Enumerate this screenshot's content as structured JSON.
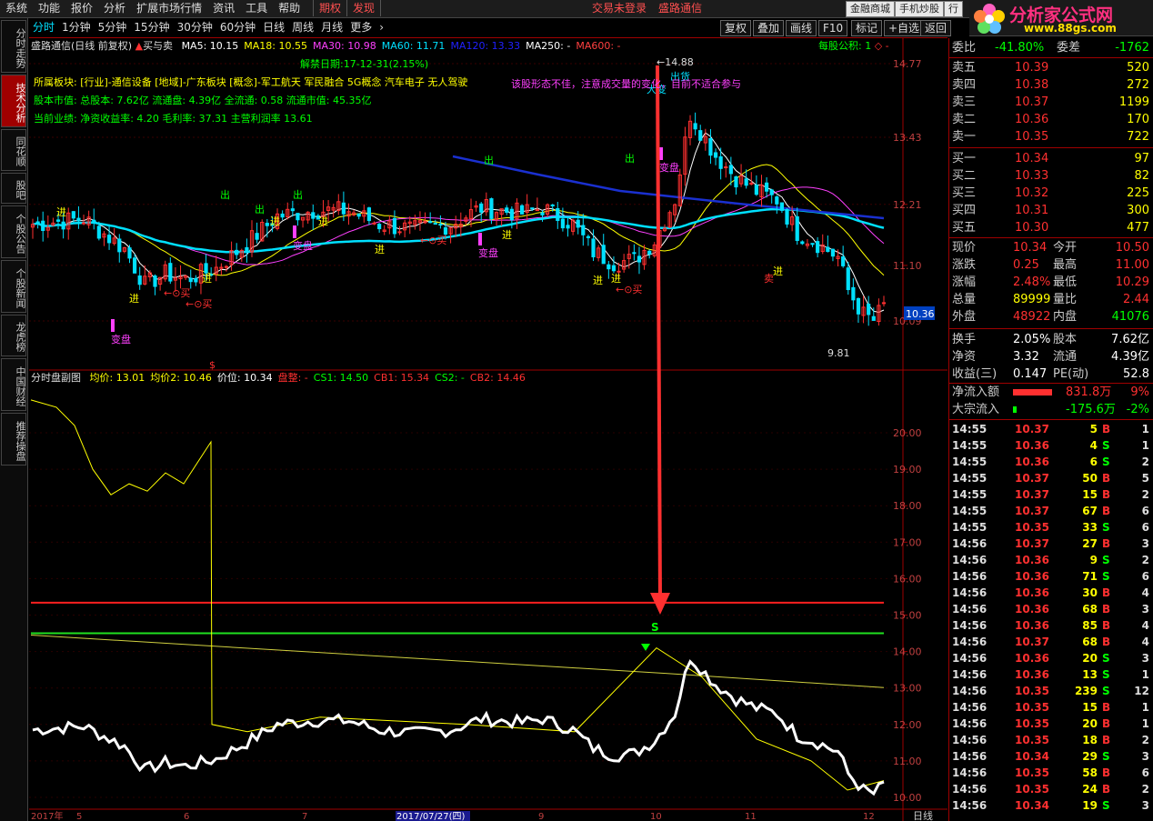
{
  "menu": {
    "items": [
      "系统",
      "功能",
      "报价",
      "分析",
      "扩展市场行情",
      "资讯",
      "工具",
      "帮助"
    ],
    "center_items": [
      "期权",
      "发现"
    ],
    "status": "交易未登录",
    "stock_name_title": "盛路通信",
    "right_buttons": [
      "金融商城",
      "手机炒股",
      "行"
    ]
  },
  "logo": {
    "title": "分析家公式网",
    "url": "www.88gs.com"
  },
  "left_tabs": [
    "分时走势",
    "技术分析",
    "同花顺",
    "股吧",
    "个股公告",
    "个股新闻",
    "龙虎榜",
    "中国财经",
    "推荐操盘"
  ],
  "period_bar": {
    "items": [
      "分时",
      "1分钟",
      "5分钟",
      "15分钟",
      "30分钟",
      "60分钟",
      "日线",
      "周线",
      "月线",
      "更多",
      "›"
    ],
    "active": "分时",
    "right_buttons": [
      "复权",
      "叠加",
      "画线",
      "F10",
      "标记",
      "+自选",
      "返回"
    ]
  },
  "main_chart": {
    "title": "盛路通信(日线 前复权)",
    "indicator_name": "买与卖",
    "ma": [
      {
        "label": "MA5: 10.15",
        "color": "#ffffff"
      },
      {
        "label": "MA18: 10.55",
        "color": "#ffff00"
      },
      {
        "label": "MA30: 10.98",
        "color": "#ff40ff"
      },
      {
        "label": "MA60: 11.71",
        "color": "#00e0ff"
      },
      {
        "label": "MA120: 13.33",
        "color": "#2020ff"
      },
      {
        "label": "MA250: -",
        "color": "#ffffff"
      },
      {
        "label": "MA600: -",
        "color": "#ff4040"
      }
    ],
    "right_info": "每股公积: 1",
    "unlock": "解禁日期:17-12-31(2.15%)",
    "info_lines": [
      "所属板块: [行业]-通信设备 [地域]-广东板块 [概念]-军工航天 军民融合 5G概念 汽车电子 无人驾驶",
      "股本市值: 总股本: 7.62亿 流通盘: 4.39亿 全流通: 0.58 流通市值: 45.35亿",
      "当前业绩: 净资收益率: 4.20 毛利率: 37.31 主营利润率 13.61"
    ],
    "warning": "该股形态不佳，注意成交量的变化，目前不适合参与",
    "y_ticks": [
      "14.77",
      "13.43",
      "12.21",
      "11.10",
      "10.09"
    ],
    "price_tag": "10.36",
    "high_label": "14.88",
    "low_label": "9.81",
    "signal_labels": {
      "jin": "进",
      "chu": "出",
      "buy": "买",
      "sell": "卖",
      "bianpan": "变盘",
      "chuhuo": "出货",
      "dabian": "大变"
    },
    "colors": {
      "up": "#ff3030",
      "down": "#00e0ff"
    }
  },
  "sub_chart": {
    "title": "分时盘副图",
    "items": [
      {
        "label": "均价: 13.01",
        "color": "#ffff00"
      },
      {
        "label": "均价2: 10.46",
        "color": "#ffff00"
      },
      {
        "label": "价位: 10.34",
        "color": "#ffffff"
      },
      {
        "label": "盘整: -",
        "color": "#ff3030"
      },
      {
        "label": "CS1: 14.50",
        "color": "#00ff00"
      },
      {
        "label": "CB1: 15.34",
        "color": "#ff3030"
      },
      {
        "label": "CS2: -",
        "color": "#00ff00"
      },
      {
        "label": "CB2: 14.46",
        "color": "#ff3030"
      }
    ],
    "y_ticks": [
      "20.00",
      "19.00",
      "18.00",
      "17.00",
      "16.00",
      "15.00",
      "14.00",
      "13.00",
      "12.00",
      "11.00",
      "10.00"
    ],
    "s_marker": "S",
    "dollar": "$"
  },
  "x_axis": {
    "labels": [
      "2017年",
      "5",
      "6",
      "7",
      "2017/07/27(四)",
      "9",
      "10",
      "11",
      "12"
    ],
    "right": "日线"
  },
  "quote": {
    "header_l": "委比",
    "header_lv": "-41.80%",
    "header_r": "委差",
    "header_rv": "-1762",
    "sell": [
      {
        "label": "卖五",
        "price": "10.39",
        "vol": "520"
      },
      {
        "label": "卖四",
        "price": "10.38",
        "vol": "272"
      },
      {
        "label": "卖三",
        "price": "10.37",
        "vol": "1199"
      },
      {
        "label": "卖二",
        "price": "10.36",
        "vol": "170"
      },
      {
        "label": "卖一",
        "price": "10.35",
        "vol": "722"
      }
    ],
    "buy": [
      {
        "label": "买一",
        "price": "10.34",
        "vol": "97"
      },
      {
        "label": "买二",
        "price": "10.33",
        "vol": "82"
      },
      {
        "label": "买三",
        "price": "10.32",
        "vol": "225"
      },
      {
        "label": "买四",
        "price": "10.31",
        "vol": "300"
      },
      {
        "label": "买五",
        "price": "10.30",
        "vol": "477"
      }
    ],
    "stats": [
      {
        "l": "现价",
        "lv": "10.34",
        "lc": "#ff3030",
        "r": "今开",
        "rv": "10.50",
        "rc": "#ff3030"
      },
      {
        "l": "涨跌",
        "lv": "0.25",
        "lc": "#ff3030",
        "r": "最高",
        "rv": "11.00",
        "rc": "#ff3030"
      },
      {
        "l": "涨幅",
        "lv": "2.48%",
        "lc": "#ff3030",
        "r": "最低",
        "rv": "10.29",
        "rc": "#ff3030"
      },
      {
        "l": "总量",
        "lv": "89999",
        "lc": "#ffff00",
        "r": "量比",
        "rv": "2.44",
        "rc": "#ff3030"
      },
      {
        "l": "外盘",
        "lv": "48922",
        "lc": "#ff3030",
        "r": "内盘",
        "rv": "41076",
        "rc": "#00ff00"
      },
      {
        "l": "换手",
        "lv": "2.05%",
        "lc": "#ffffff",
        "r": "股本",
        "rv": "7.62亿",
        "rc": "#ffffff"
      },
      {
        "l": "净资",
        "lv": "3.32",
        "lc": "#ffffff",
        "r": "流通",
        "rv": "4.39亿",
        "rc": "#ffffff"
      },
      {
        "l": "收益(三)",
        "lv": "0.147",
        "lc": "#ffffff",
        "r": "PE(动)",
        "rv": "52.8",
        "rc": "#ffffff"
      }
    ],
    "flow": [
      {
        "label": "净流入额",
        "value": "831.8万",
        "pct": "9%",
        "color": "#ff3030",
        "bar": 0.9
      },
      {
        "label": "大宗流入",
        "value": "-175.6万",
        "pct": "-2%",
        "color": "#00ff00",
        "bar": 0.08
      }
    ]
  },
  "ticks": [
    {
      "t": "14:55",
      "p": "10.37",
      "v": "5",
      "s": "B",
      "n": "1"
    },
    {
      "t": "14:55",
      "p": "10.36",
      "v": "4",
      "s": "S",
      "n": "1"
    },
    {
      "t": "14:55",
      "p": "10.36",
      "v": "6",
      "s": "S",
      "n": "2"
    },
    {
      "t": "14:55",
      "p": "10.37",
      "v": "50",
      "s": "B",
      "n": "5"
    },
    {
      "t": "14:55",
      "p": "10.37",
      "v": "15",
      "s": "B",
      "n": "2"
    },
    {
      "t": "14:55",
      "p": "10.37",
      "v": "67",
      "s": "B",
      "n": "6"
    },
    {
      "t": "14:55",
      "p": "10.35",
      "v": "33",
      "s": "S",
      "n": "6"
    },
    {
      "t": "14:56",
      "p": "10.37",
      "v": "27",
      "s": "B",
      "n": "3"
    },
    {
      "t": "14:56",
      "p": "10.36",
      "v": "9",
      "s": "S",
      "n": "2"
    },
    {
      "t": "14:56",
      "p": "10.36",
      "v": "71",
      "s": "S",
      "n": "6"
    },
    {
      "t": "14:56",
      "p": "10.36",
      "v": "30",
      "s": "B",
      "n": "4"
    },
    {
      "t": "14:56",
      "p": "10.36",
      "v": "68",
      "s": "B",
      "n": "3"
    },
    {
      "t": "14:56",
      "p": "10.36",
      "v": "85",
      "s": "B",
      "n": "4"
    },
    {
      "t": "14:56",
      "p": "10.37",
      "v": "68",
      "s": "B",
      "n": "4"
    },
    {
      "t": "14:56",
      "p": "10.36",
      "v": "20",
      "s": "S",
      "n": "3"
    },
    {
      "t": "14:56",
      "p": "10.36",
      "v": "13",
      "s": "S",
      "n": "1"
    },
    {
      "t": "14:56",
      "p": "10.35",
      "v": "239",
      "s": "S",
      "n": "12"
    },
    {
      "t": "14:56",
      "p": "10.35",
      "v": "15",
      "s": "B",
      "n": "1"
    },
    {
      "t": "14:56",
      "p": "10.35",
      "v": "20",
      "s": "B",
      "n": "1"
    },
    {
      "t": "14:56",
      "p": "10.35",
      "v": "18",
      "s": "B",
      "n": "2"
    },
    {
      "t": "14:56",
      "p": "10.34",
      "v": "29",
      "s": "S",
      "n": "3"
    },
    {
      "t": "14:56",
      "p": "10.35",
      "v": "58",
      "s": "B",
      "n": "6"
    },
    {
      "t": "14:56",
      "p": "10.35",
      "v": "24",
      "s": "B",
      "n": "2"
    },
    {
      "t": "14:56",
      "p": "10.34",
      "v": "19",
      "s": "S",
      "n": "3"
    }
  ]
}
